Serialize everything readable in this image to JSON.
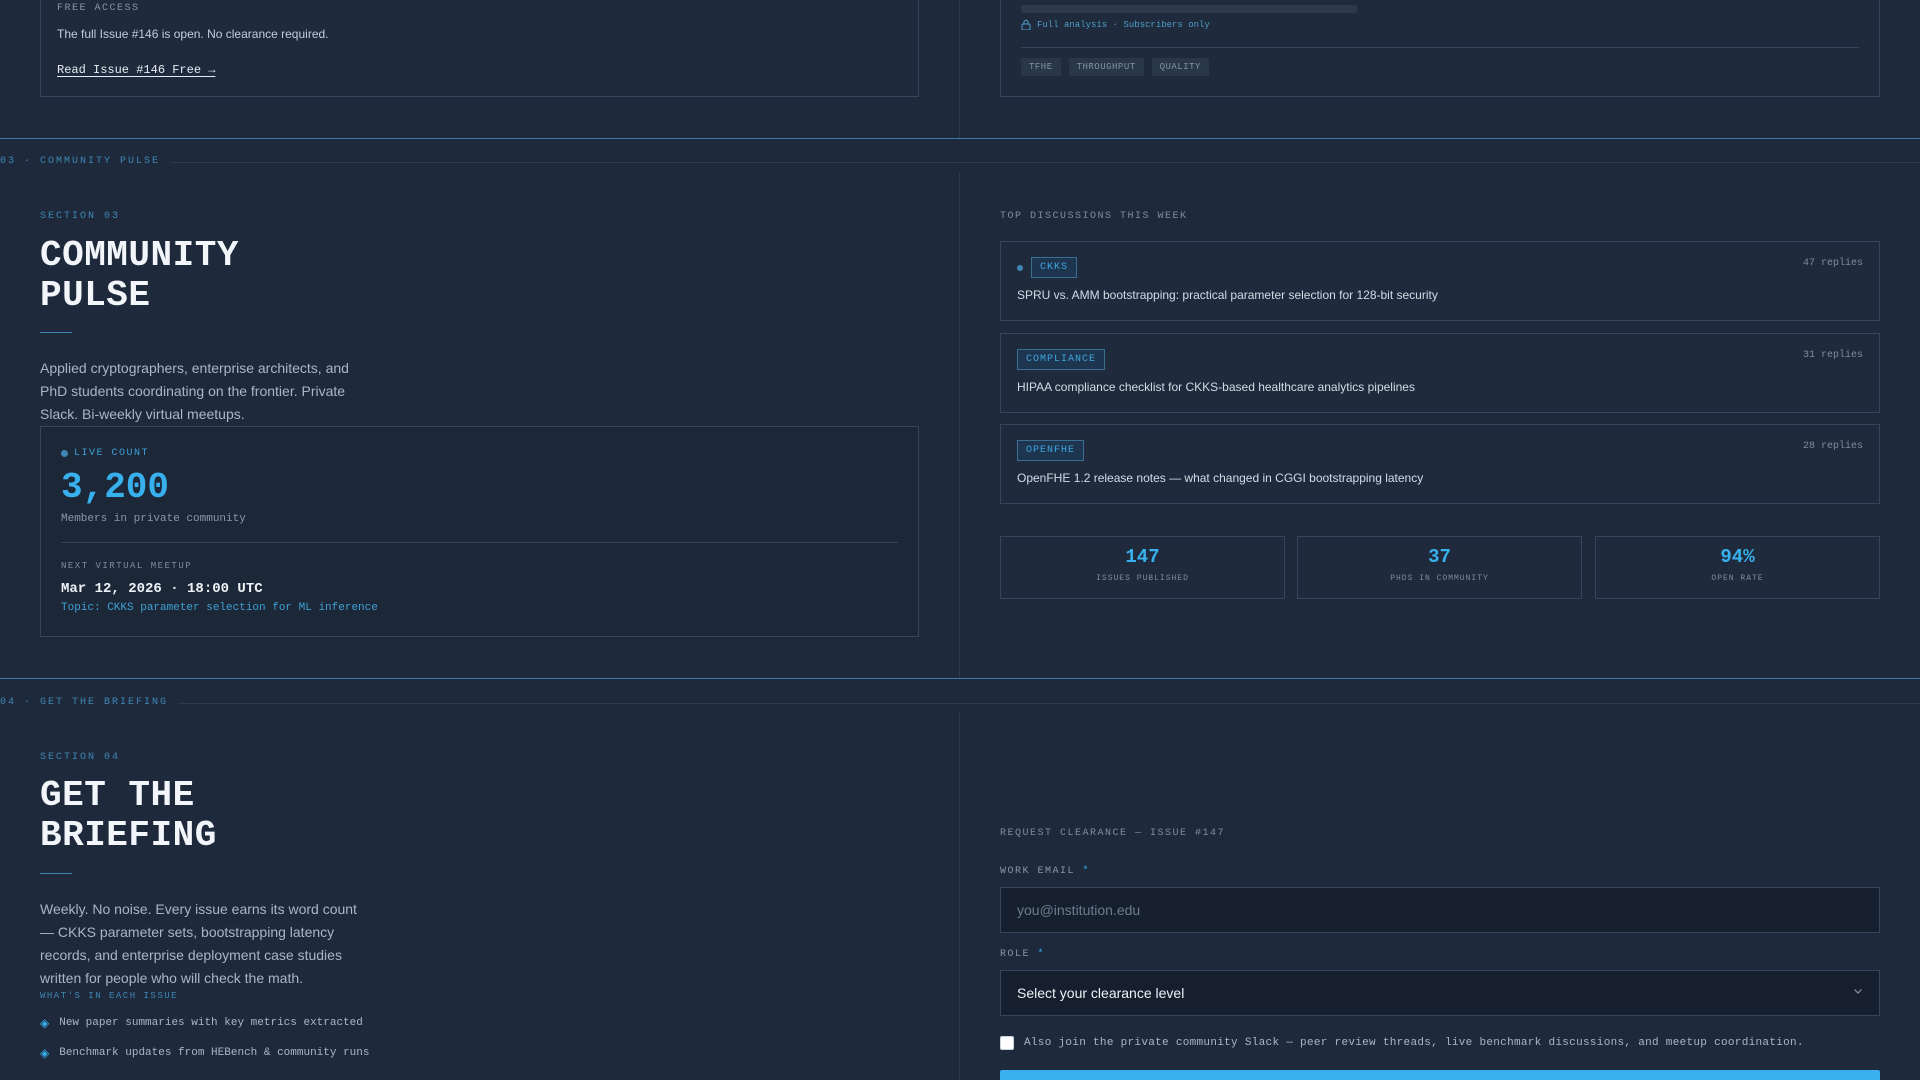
{
  "section02": {
    "free_label": "FREE ACCESS",
    "free_text": "The full Issue #146 is open. No clearance required.",
    "free_link": "Read Issue #146 Free →",
    "locked_text": "Full analysis · Subscribers only",
    "tags": [
      "TFHE",
      "THROUGHPUT",
      "QUALITY"
    ]
  },
  "section03": {
    "divider_label": "03 · COMMUNITY PULSE",
    "eyebrow": "SECTION 03",
    "title_line1": "COMMUNITY",
    "title_line2": "PULSE",
    "description": "Applied cryptographers, enterprise architects, and PhD students coordinating on the frontier. Private Slack. Bi-weekly virtual meetups.",
    "live": {
      "label": "LIVE COUNT",
      "count": "3,200",
      "sub": "Members in private community",
      "meetup_label": "NEXT VIRTUAL MEETUP",
      "meetup_date": "Mar 12, 2026 · 18:00 UTC",
      "meetup_topic": "Topic: CKKS parameter selection for ML inference"
    },
    "discussions_heading": "TOP DISCUSSIONS THIS WEEK",
    "discussions": [
      {
        "tag": "CKKS",
        "replies": "47 replies",
        "title": "SPRU vs. AMM bootstrapping: practical parameter selection for 128-bit security",
        "active": true
      },
      {
        "tag": "COMPLIANCE",
        "replies": "31 replies",
        "title": "HIPAA compliance checklist for CKKS-based healthcare analytics pipelines",
        "active": false
      },
      {
        "tag": "OPENFHE",
        "replies": "28 replies",
        "title": "OpenFHE 1.2 release notes — what changed in CGGI bootstrapping latency",
        "active": false
      }
    ],
    "stats": [
      {
        "value": "147",
        "label": "ISSUES PUBLISHED"
      },
      {
        "value": "37",
        "label": "PHDS IN COMMUNITY"
      },
      {
        "value": "94%",
        "label": "OPEN RATE"
      }
    ]
  },
  "section04": {
    "divider_label": "04 · GET THE BRIEFING",
    "eyebrow": "SECTION 04",
    "title_line1": "GET THE",
    "title_line2": "BRIEFING",
    "description": "Weekly. No noise. Every issue earns its word count — CKKS parameter sets, bootstrapping latency records, and enterprise deployment case studies written for people who will check the math.",
    "includes_label": "WHAT'S IN EACH ISSUE",
    "includes": [
      "New paper summaries with key metrics extracted",
      "Benchmark updates from HEBench & community runs"
    ],
    "form": {
      "heading": "REQUEST CLEARANCE — ISSUE #147",
      "email_label": "WORK EMAIL",
      "email_placeholder": "you@institution.edu",
      "email_value": "",
      "role_label": "ROLE",
      "role_selected": "Select your clearance level",
      "required_mark": "*",
      "slack_optin": "Also join the private community Slack — peer review threads, live benchmark discussions, and meetup coordination.",
      "slack_checked": false
    }
  }
}
